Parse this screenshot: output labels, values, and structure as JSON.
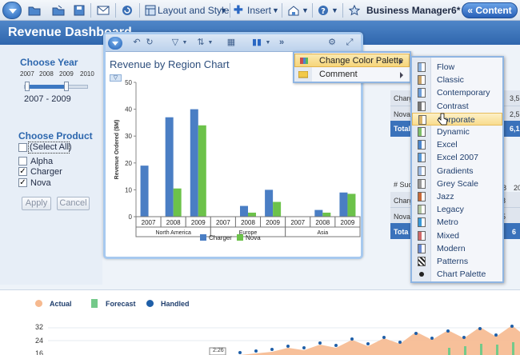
{
  "toolbar": {
    "layout_style_label": "Layout and Style",
    "insert_label": "Insert",
    "document_title": "Business Manager6*",
    "content_button_label": "« Content",
    "help_icon": "help-icon"
  },
  "header": {
    "title": "Revenue Dashboard"
  },
  "left_panel": {
    "choose_year_title": "Choose Year",
    "years": [
      "2007",
      "2008",
      "2009",
      "2010"
    ],
    "selected_range": "2007 - 2009",
    "choose_product_title": "Choose Product",
    "products": [
      {
        "label": "(Select All)",
        "checked": false
      },
      {
        "label": "Alpha",
        "checked": false
      },
      {
        "label": "Charger",
        "checked": true
      },
      {
        "label": "Nova",
        "checked": true
      }
    ],
    "apply_label": "Apply",
    "cancel_label": "Cancel"
  },
  "chart_window": {
    "title": "Revenue by Region Chart",
    "legend": [
      {
        "name": "Charger",
        "color": "#4a7ec4"
      },
      {
        "name": "Nova",
        "color": "#6cc24a"
      }
    ]
  },
  "chart_data": {
    "type": "bar",
    "title": "Revenue by Region Chart",
    "ylabel": "Revenue Ordered ($M)",
    "xlabel": "",
    "ylim": [
      0,
      50
    ],
    "yticks": [
      0,
      10,
      20,
      30,
      40,
      50
    ],
    "groups": [
      "North America",
      "Europe",
      "Asia"
    ],
    "categories": [
      "2007",
      "2008",
      "2009"
    ],
    "series": [
      {
        "name": "Charger",
        "color": "#4a7ec4",
        "values": [
          [
            19,
            37,
            40
          ],
          [
            0,
            4,
            10
          ],
          [
            0,
            2.5,
            9
          ]
        ]
      },
      {
        "name": "Nova",
        "color": "#6cc24a",
        "values": [
          [
            0,
            10.5,
            34
          ],
          [
            0,
            1.5,
            5.5
          ],
          [
            0,
            1.5,
            8.5
          ]
        ]
      }
    ]
  },
  "context_menu": {
    "items": [
      {
        "label": "Change Color Palette",
        "highlighted": true
      },
      {
        "label": "Comment",
        "highlighted": false
      }
    ]
  },
  "palette_menu": {
    "items": [
      "Flow",
      "Classic",
      "Contemporary",
      "Contrast",
      "Corporate",
      "Dynamic",
      "Excel",
      "Excel 2007",
      "Gradients",
      "Grey Scale",
      "Jazz",
      "Legacy",
      "Metro",
      "Mixed",
      "Modern",
      "Patterns",
      "Chart Palette"
    ],
    "highlighted_index": 4
  },
  "right_tables": {
    "top": {
      "rows": [
        [
          "Charger",
          "3",
          "3,5"
        ],
        [
          "Nova",
          "2",
          "2,5"
        ]
      ],
      "total": [
        "Total",
        "",
        "6,1"
      ]
    },
    "mid_header": [
      "# Suc",
      "",
      "08",
      "20"
    ],
    "bottom": {
      "rows": [
        [
          "Charg",
          "",
          "63"
        ],
        [
          "Nova",
          "",
          "35"
        ]
      ],
      "total": [
        "Tota",
        "",
        "69",
        "6"
      ]
    }
  },
  "bottom_chart": {
    "legend": [
      {
        "name": "Actual",
        "color": "#f6b98f"
      },
      {
        "name": "Forecast",
        "color": "#74c98a"
      },
      {
        "name": "Handled",
        "color": "#1f5fa8"
      }
    ],
    "yticks": [
      "32",
      "24",
      "16"
    ],
    "tooltip": "2:26"
  }
}
